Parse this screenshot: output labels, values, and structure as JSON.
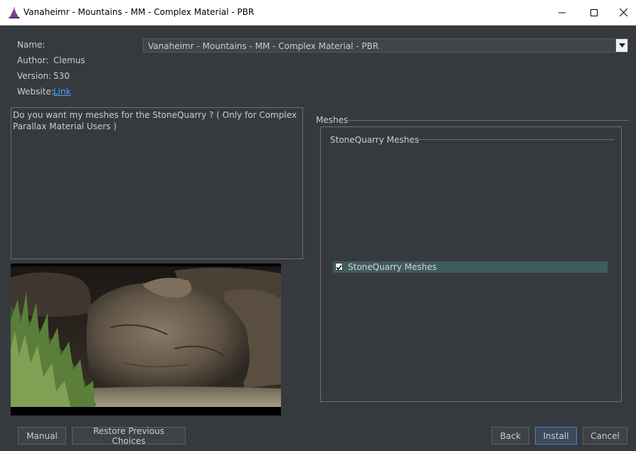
{
  "window": {
    "title": "Vanaheimr - Mountains - MM - Complex Material - PBR"
  },
  "info": {
    "name_label": "Name:",
    "author_label": "Author:",
    "author": "Clemus",
    "version_label": "Version:",
    "version": "530",
    "website_label": "Website:",
    "website_link": "Link",
    "selected_name": "Vanaheimr - Mountains - MM - Complex Material - PBR"
  },
  "description": "Do you want my meshes for the StoneQuarry ? ( Only for Complex Parallax Material Users )",
  "meshes": {
    "group_title": "Meshes",
    "subgroup_title": "StoneQuarry Meshes",
    "option_label": "StoneQuarry Meshes",
    "option_checked": true
  },
  "buttons": {
    "manual": "Manual",
    "restore": "Restore Previous Choices",
    "back": "Back",
    "install": "Install",
    "cancel": "Cancel"
  },
  "icons": {
    "app": "wizard-hat-icon",
    "minimize": "minimize-icon",
    "maximize": "maximize-icon",
    "close": "close-icon",
    "dropdown": "chevron-down-icon",
    "check": "checkmark-icon"
  },
  "colors": {
    "background": "#363a3e",
    "link": "#4aa0ff",
    "selection": "#3f5b5e",
    "primary_border": "#4f7fbf"
  }
}
